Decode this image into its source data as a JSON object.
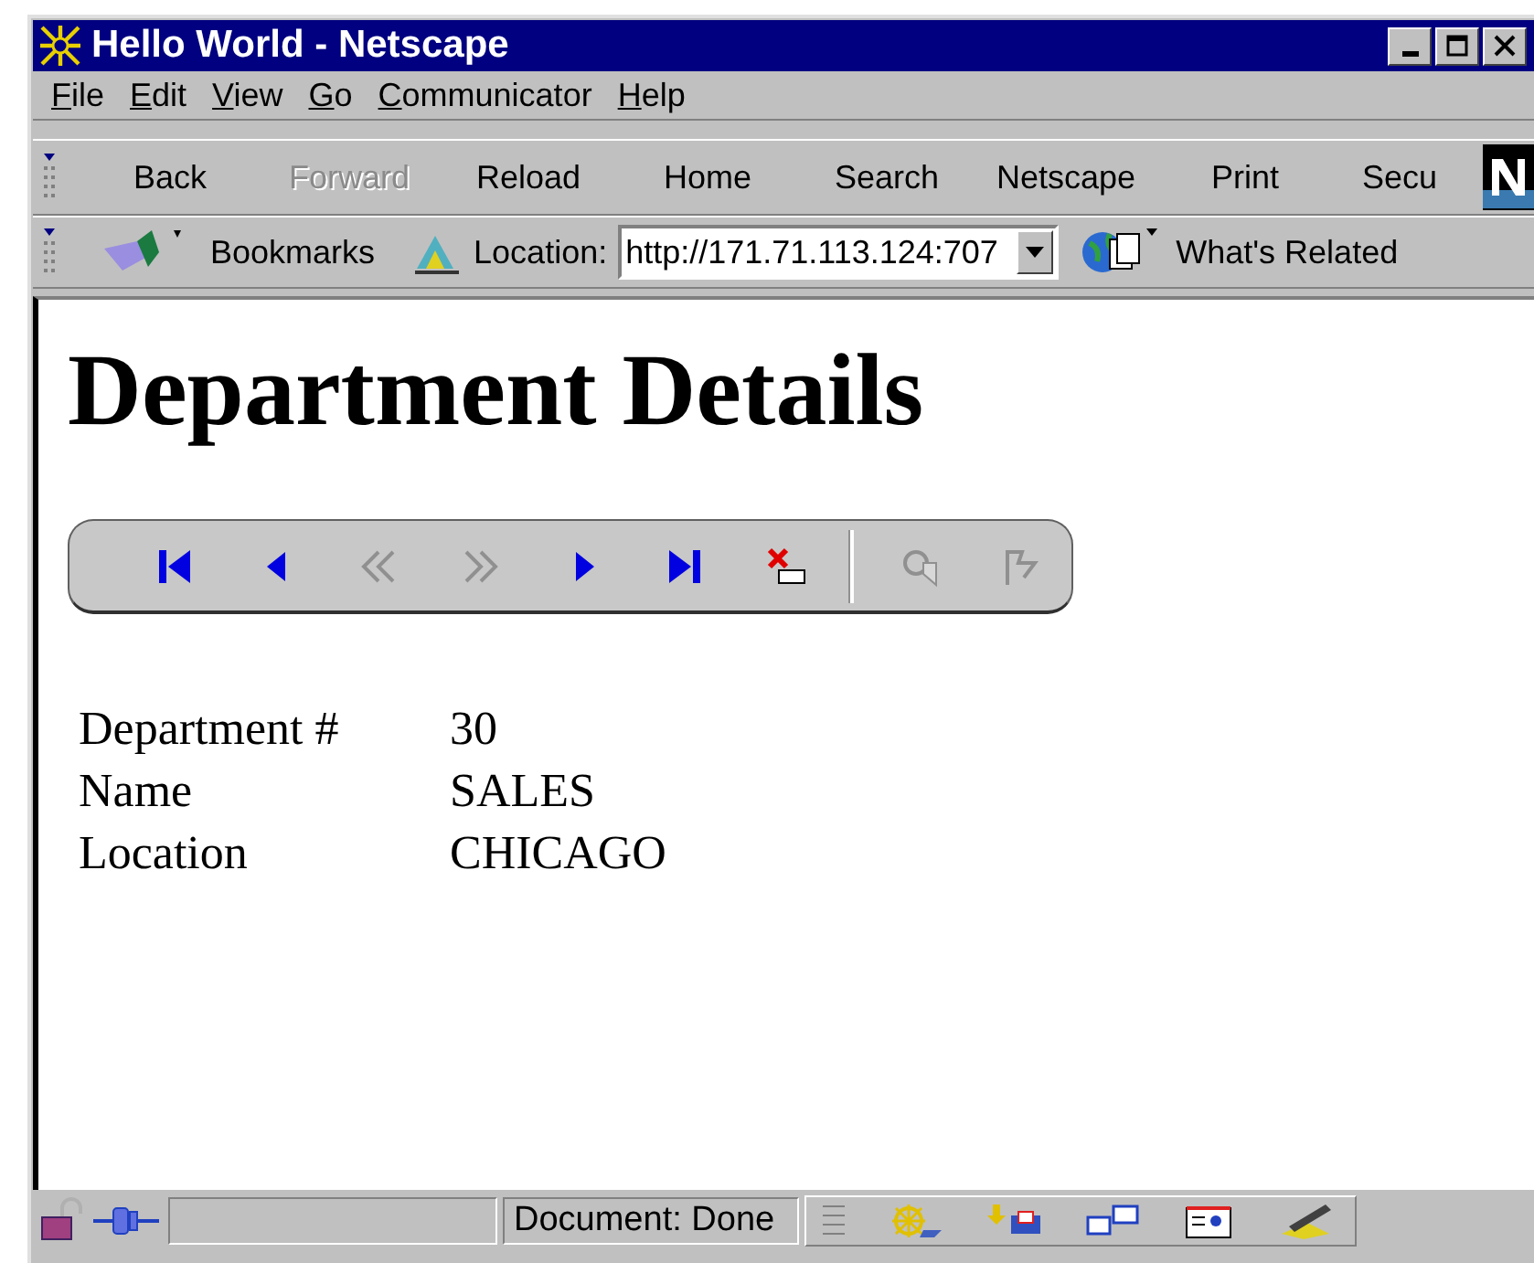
{
  "window": {
    "title": "Hello World - Netscape"
  },
  "menu": [
    {
      "label": "File"
    },
    {
      "label": "Edit"
    },
    {
      "label": "View"
    },
    {
      "label": "Go"
    },
    {
      "label": "Communicator"
    },
    {
      "label": "Help"
    }
  ],
  "navigation_toolbar": [
    {
      "label": "Back",
      "disabled": false
    },
    {
      "label": "Forward",
      "disabled": true
    },
    {
      "label": "Reload",
      "disabled": false
    },
    {
      "label": "Home",
      "disabled": false
    },
    {
      "label": "Search",
      "disabled": false
    },
    {
      "label": "Netscape",
      "disabled": false
    },
    {
      "label": "Print",
      "disabled": false
    },
    {
      "label": "Secu",
      "disabled": false
    }
  ],
  "location_toolbar": {
    "bookmarks": "Bookmarks",
    "location_label": "Location:",
    "url": "http://171.71.113.124:707",
    "related": "What's Related"
  },
  "page": {
    "heading": "Department Details",
    "record_toolbar": [
      {
        "kind": "first",
        "disabled": false
      },
      {
        "kind": "previous",
        "disabled": false
      },
      {
        "kind": "previous-set",
        "disabled": true
      },
      {
        "kind": "next-set",
        "disabled": true
      },
      {
        "kind": "next",
        "disabled": false
      },
      {
        "kind": "last",
        "disabled": false
      },
      {
        "kind": "delete",
        "disabled": false
      },
      {
        "kind": "separator"
      },
      {
        "kind": "query",
        "disabled": true
      },
      {
        "kind": "execute",
        "disabled": true
      }
    ],
    "fields": [
      {
        "label": "Department #",
        "value": "30"
      },
      {
        "label": "Name",
        "value": "SALES"
      },
      {
        "label": "Location",
        "value": "CHICAGO"
      }
    ]
  },
  "status_bar": {
    "text": "Document: Done"
  }
}
